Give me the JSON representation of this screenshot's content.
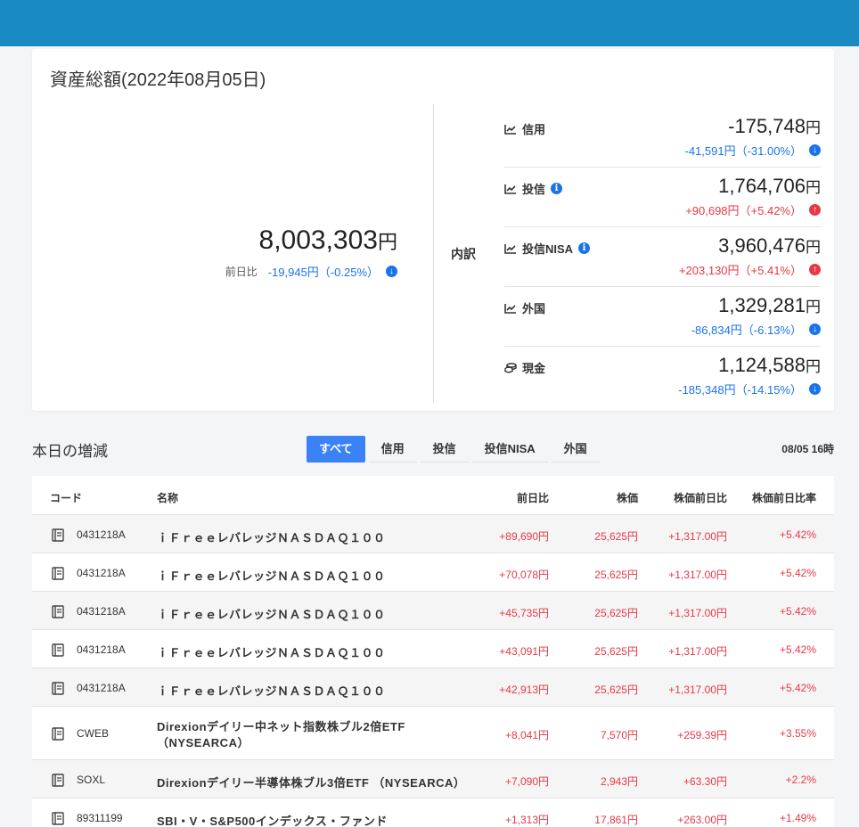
{
  "summary": {
    "title": "資産総額(2022年08月05日)",
    "total_amount": "8,003,303",
    "yen": "円",
    "diff_label": "前日比",
    "total_diff": "-19,945円（-0.25%）",
    "breakdown_label": "内訳"
  },
  "breakdown": [
    {
      "name": "信用",
      "amount": "-175,748",
      "diff": "-41,591円（-31.00%）",
      "direction": "down",
      "info": false
    },
    {
      "name": "投信",
      "amount": "1,764,706",
      "diff": "+90,698円（+5.42%）",
      "direction": "up",
      "info": true
    },
    {
      "name": "投信NISA",
      "amount": "3,960,476",
      "diff": "+203,130円（+5.41%）",
      "direction": "up",
      "info": true
    },
    {
      "name": "外国",
      "amount": "1,329,281",
      "diff": "-86,834円（-6.13%）",
      "direction": "down",
      "info": false
    },
    {
      "name": "現金",
      "amount": "1,124,588",
      "diff": "-185,348円（-14.15%）",
      "direction": "down",
      "info": false
    }
  ],
  "today": {
    "title": "本日の増減",
    "tabs": [
      "すべて",
      "信用",
      "投信",
      "投信NISA",
      "外国"
    ],
    "active_tab": "すべて",
    "timestamp": "08/05 16時"
  },
  "table": {
    "headers": [
      "コード",
      "名称",
      "前日比",
      "株価",
      "株価前日比",
      "株価前日比率"
    ],
    "rows": [
      {
        "code": "0431218A",
        "name": "ｉＦｒｅｅレバレッジＮＡＳＤＡＱ１００",
        "name2": "",
        "diff": "+89,690円",
        "price": "25,625円",
        "price_diff": "+1,317.00円",
        "rate": "+5.42%"
      },
      {
        "code": "0431218A",
        "name": "ｉＦｒｅｅレバレッジＮＡＳＤＡＱ１００",
        "name2": "",
        "diff": "+70,078円",
        "price": "25,625円",
        "price_diff": "+1,317.00円",
        "rate": "+5.42%"
      },
      {
        "code": "0431218A",
        "name": "ｉＦｒｅｅレバレッジＮＡＳＤＡＱ１００",
        "name2": "",
        "diff": "+45,735円",
        "price": "25,625円",
        "price_diff": "+1,317.00円",
        "rate": "+5.42%"
      },
      {
        "code": "0431218A",
        "name": "ｉＦｒｅｅレバレッジＮＡＳＤＡＱ１００",
        "name2": "",
        "diff": "+43,091円",
        "price": "25,625円",
        "price_diff": "+1,317.00円",
        "rate": "+5.42%"
      },
      {
        "code": "0431218A",
        "name": "ｉＦｒｅｅレバレッジＮＡＳＤＡＱ１００",
        "name2": "",
        "diff": "+42,913円",
        "price": "25,625円",
        "price_diff": "+1,317.00円",
        "rate": "+5.42%"
      },
      {
        "code": "CWEB",
        "name": "Direxionデイリー中ネット指数株ブル2倍ETF",
        "name2": "（NYSEARCA）",
        "diff": "+8,041円",
        "price": "7,570円",
        "price_diff": "+259.39円",
        "rate": "+3.55%"
      },
      {
        "code": "SOXL",
        "name": "Direxionデイリー半導体株ブル3倍ETF （NYSEARCA）",
        "name2": "",
        "diff": "+7,090円",
        "price": "2,943円",
        "price_diff": "+63.30円",
        "rate": "+2.2%"
      },
      {
        "code": "89311199",
        "name": "SBI・V・S&P500インデックス・ファンド",
        "name2": "",
        "diff": "+1,313円",
        "price": "17,861円",
        "price_diff": "+263.00円",
        "rate": "+1.49%"
      }
    ]
  },
  "colors": {
    "topbar": "#1a8bc2",
    "accent": "#3b82f6",
    "positive": "#e63946",
    "negative": "#1a73e8"
  }
}
